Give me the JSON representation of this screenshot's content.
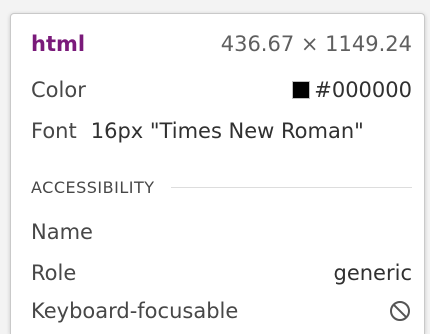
{
  "header": {
    "tag": "html",
    "dimensions": "436.67 × 1149.24"
  },
  "styles": {
    "color_label": "Color",
    "color_value": "#000000",
    "color_swatch": "#000000",
    "font_label": "Font",
    "font_value": "16px \"Times New Roman\""
  },
  "accessibility": {
    "section_title": "ACCESSIBILITY",
    "name_label": "Name",
    "name_value": "",
    "role_label": "Role",
    "role_value": "generic",
    "focusable_label": "Keyboard-focusable",
    "focusable_icon": "not-allowed-icon"
  }
}
